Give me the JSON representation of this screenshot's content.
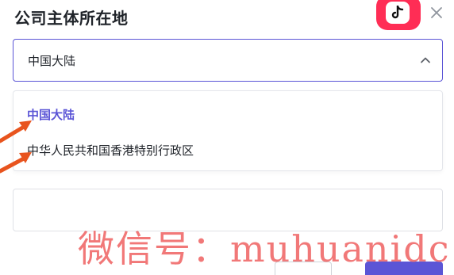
{
  "dialog": {
    "title": "公司主体所在地"
  },
  "icons": {
    "app_logo": "tiktok-logo-icon",
    "close": "close-icon",
    "chevron": "chevron-up-icon",
    "arrow": "arrow-annotation-icon"
  },
  "select": {
    "value": "中国大陆"
  },
  "dropdown": {
    "options": [
      {
        "label": "中国大陆",
        "selected": true
      },
      {
        "label": "中华人民共和国香港特别行政区",
        "selected": false
      }
    ]
  },
  "watermark": {
    "text": "微信号：muhuanidc"
  },
  "colors": {
    "accent": "#5b55d6",
    "logo": "#ff2d55",
    "arrow": "#e8541e",
    "watermark": "#f06a6a"
  }
}
